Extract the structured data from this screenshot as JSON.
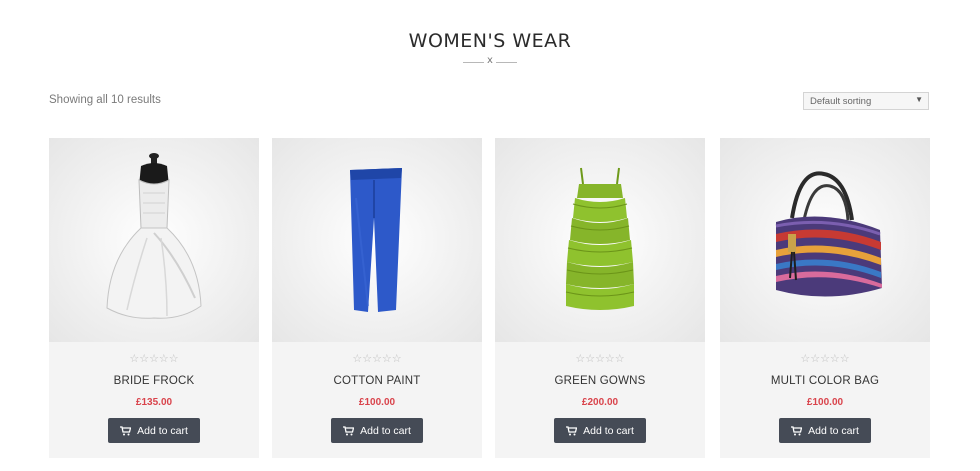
{
  "page": {
    "title": "WOMEN'S WEAR",
    "divider_mark": "x",
    "result_count": "Showing all 10 results",
    "sorting": {
      "selected": "Default sorting",
      "caret": "▼"
    }
  },
  "products": [
    {
      "name": "BRIDE FROCK",
      "price": "£135.00",
      "stars": "☆☆☆☆☆",
      "button": "Add to cart",
      "image": "white-wedding-dress"
    },
    {
      "name": "COTTON PAINT",
      "price": "£100.00",
      "stars": "☆☆☆☆☆",
      "button": "Add to cart",
      "image": "blue-trousers"
    },
    {
      "name": "GREEN GOWNS",
      "price": "£200.00",
      "stars": "☆☆☆☆☆",
      "button": "Add to cart",
      "image": "green-ruffle-dress"
    },
    {
      "name": "MULTI COLOR BAG",
      "price": "£100.00",
      "stars": "☆☆☆☆☆",
      "button": "Add to cart",
      "image": "striped-handbag"
    }
  ],
  "colors": {
    "price": "#d9434b",
    "button_bg": "#454b56",
    "card_bg": "#f4f4f4"
  }
}
